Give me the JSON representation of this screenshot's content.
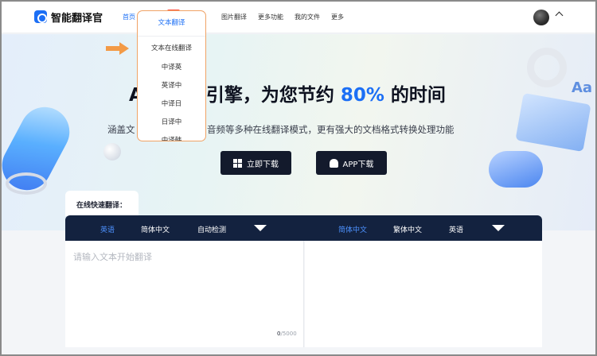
{
  "header": {
    "brand": "智能翻译官",
    "nav": [
      {
        "label": "首页"
      },
      {
        "label": "图片翻译"
      },
      {
        "label": "更多功能"
      },
      {
        "label": "我的文件"
      },
      {
        "label": "更多"
      }
    ]
  },
  "dropdown": {
    "head": "文本翻译",
    "items": [
      "文本在线翻译",
      "中译英",
      "英译中",
      "中译日",
      "日译中",
      "中译韩"
    ]
  },
  "hero": {
    "title_start": "A",
    "title_mid": "译引擎，为您节约 ",
    "title_highlight": "80%",
    "title_end": " 的时间",
    "subtitle_start": "涵盖文",
    "subtitle_end": "视频、音频等多种在线翻译模式，更有强大的文档格式转换处理功能",
    "btn_download": "立即下载",
    "btn_app": "APP下载"
  },
  "panel": {
    "tab_label": "在线快速翻译：",
    "source_langs": [
      "英语",
      "简体中文",
      "自动检测"
    ],
    "target_langs": [
      "简体中文",
      "繁体中文",
      "英语"
    ],
    "placeholder": "请输入文本开始翻译",
    "counter_current": "0",
    "counter_max": "/5000"
  },
  "colors": {
    "accent": "#1c6ff5",
    "dark_bar": "#13223f",
    "highlight_border": "#f0a366",
    "arrow": "#f39a46"
  }
}
